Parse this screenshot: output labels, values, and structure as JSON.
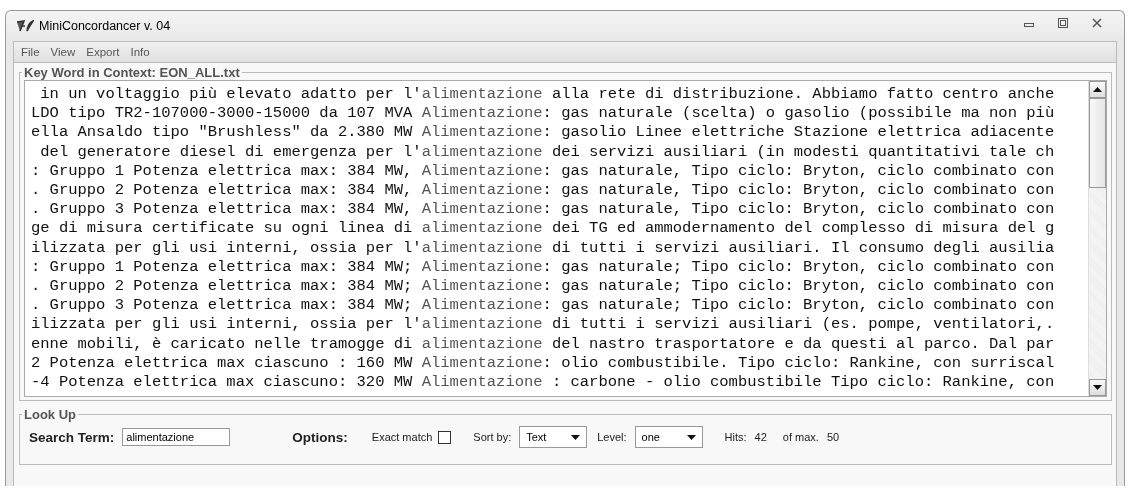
{
  "window": {
    "title": "MiniConcordancer v. 04"
  },
  "menu": [
    "File",
    "View",
    "Export",
    "Info"
  ],
  "kwic": {
    "title": "Key Word in Context: EON_ALL.txt",
    "lines": [
      {
        "left": " in un voltaggio più elevato adatto per l'",
        "keyword": "alimentazione",
        "right": " alla rete di distribuzione. Abbiamo fatto centro anche"
      },
      {
        "left": "LDO tipo TR2-107000-3000-15000 da 107 MVA ",
        "keyword": "Alimentazione",
        "right": ": gas naturale (scelta) o gasolio (possibile ma non più"
      },
      {
        "left": "ella Ansaldo tipo \"Brushless\" da 2.380 MW ",
        "keyword": "Alimentazione",
        "right": ": gasolio Linee elettriche Stazione elettrica adiacente"
      },
      {
        "left": " del generatore diesel di emergenza per l'",
        "keyword": "alimentazione",
        "right": " dei servizi ausiliari (in modesti quantitativi tale ch"
      },
      {
        "left": ": Gruppo 1 Potenza elettrica max: 384 MW, ",
        "keyword": "Alimentazione",
        "right": ": gas naturale, Tipo ciclo: Bryton, ciclo combinato con"
      },
      {
        "left": ". Gruppo 2 Potenza elettrica max: 384 MW, ",
        "keyword": "Alimentazione",
        "right": ": gas naturale, Tipo ciclo: Bryton, ciclo combinato con"
      },
      {
        "left": ". Gruppo 3 Potenza elettrica max: 384 MW, ",
        "keyword": "Alimentazione",
        "right": ": gas naturale, Tipo ciclo: Bryton, ciclo combinato con"
      },
      {
        "left": "ge di misura certificate su ogni linea di ",
        "keyword": "alimentazione",
        "right": " dei TG ed ammodernamento del complesso di misura del g"
      },
      {
        "left": "ilizzata per gli usi interni, ossia per l'",
        "keyword": "alimentazione",
        "right": " di tutti i servizi ausiliari. Il consumo degli ausilia"
      },
      {
        "left": ": Gruppo 1 Potenza elettrica max: 384 MW; ",
        "keyword": "Alimentazione",
        "right": ": gas naturale; Tipo ciclo: Bryton, ciclo combinato con"
      },
      {
        "left": ". Gruppo 2 Potenza elettrica max: 384 MW; ",
        "keyword": "Alimentazione",
        "right": ": gas naturale; Tipo ciclo: Bryton, ciclo combinato con"
      },
      {
        "left": ". Gruppo 3 Potenza elettrica max: 384 MW; ",
        "keyword": "Alimentazione",
        "right": ": gas naturale; Tipo ciclo: Bryton, ciclo combinato con"
      },
      {
        "left": "ilizzata per gli usi interni, ossia per l'",
        "keyword": "alimentazione",
        "right": " di tutti i servizi ausiliari (es. pompe, ventilatori,."
      },
      {
        "left": "enne mobili, è caricato nelle tramogge di ",
        "keyword": "alimentazione",
        "right": " del nastro trasportatore e da questi al parco. Dal par"
      },
      {
        "left": "2 Potenza elettrica max ciascuno : 160 MW ",
        "keyword": "Alimentazione",
        "right": ": olio combustibile. Tipo ciclo: Rankine, con surriscal"
      },
      {
        "left": "-4 Potenza elettrica max ciascuno: 320 MW ",
        "keyword": "Alimentazione",
        "right": " : carbone - olio combustibile Tipo ciclo: Rankine, con"
      }
    ]
  },
  "lookup": {
    "title": "Look Up",
    "search_label": "Search Term:",
    "search_value": "alimentazione",
    "options_label": "Options:",
    "exact_match": {
      "label": "Exact match",
      "checked": false
    },
    "sort": {
      "label": "Sort by:",
      "value": "Text"
    },
    "level": {
      "label": "Level:",
      "value": "one"
    },
    "hits_label": "Hits:",
    "hits": "42",
    "max_label": "of max.",
    "max": "50"
  }
}
